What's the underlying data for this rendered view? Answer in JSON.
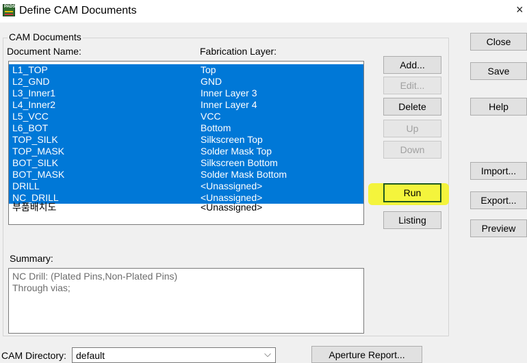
{
  "window": {
    "title": "Define CAM Documents",
    "close_glyph": "×",
    "icon": "pads-app-icon",
    "icon_text": "PADS"
  },
  "group_title": "CAM Documents",
  "columns": {
    "doc_name": "Document Name:",
    "fab_layer": "Fabrication Layer:"
  },
  "documents": [
    {
      "name": "L1_TOP",
      "layer": "Top",
      "selected": true
    },
    {
      "name": "L2_GND",
      "layer": "GND",
      "selected": true
    },
    {
      "name": "L3_Inner1",
      "layer": "Inner Layer 3",
      "selected": true
    },
    {
      "name": "L4_Inner2",
      "layer": "Inner Layer 4",
      "selected": true
    },
    {
      "name": "L5_VCC",
      "layer": "VCC",
      "selected": true
    },
    {
      "name": "L6_BOT",
      "layer": "Bottom",
      "selected": true
    },
    {
      "name": "TOP_SILK",
      "layer": "Silkscreen Top",
      "selected": true
    },
    {
      "name": "TOP_MASK",
      "layer": "Solder Mask Top",
      "selected": true
    },
    {
      "name": "BOT_SILK",
      "layer": "Silkscreen Bottom",
      "selected": true
    },
    {
      "name": "BOT_MASK",
      "layer": "Solder Mask Bottom",
      "selected": true
    },
    {
      "name": "DRILL",
      "layer": "<Unassigned>",
      "selected": true
    },
    {
      "name": "NC_DRILL",
      "layer": "<Unassigned>",
      "selected": true
    },
    {
      "name": "부품배치도",
      "layer": "<Unassigned>",
      "selected": false
    }
  ],
  "doc_buttons": {
    "add": "Add...",
    "edit": "Edit...",
    "delete": "Delete",
    "up": "Up",
    "down": "Down",
    "run": "Run",
    "listing": "Listing"
  },
  "side_buttons": {
    "close": "Close",
    "save": "Save",
    "help": "Help",
    "import": "Import...",
    "export": "Export...",
    "preview": "Preview"
  },
  "summary": {
    "label": "Summary:",
    "lines": [
      "NC Drill: (Plated Pins,Non-Plated Pins)",
      "Through vias;"
    ]
  },
  "cam_directory": {
    "label": "CAM Directory:",
    "value": "default",
    "chevron": "⌵"
  },
  "aperture_button": "Aperture Report...",
  "colors": {
    "selection": "#0078d7",
    "highlight": "#f4f428",
    "run_border": "#1e5a1e"
  }
}
